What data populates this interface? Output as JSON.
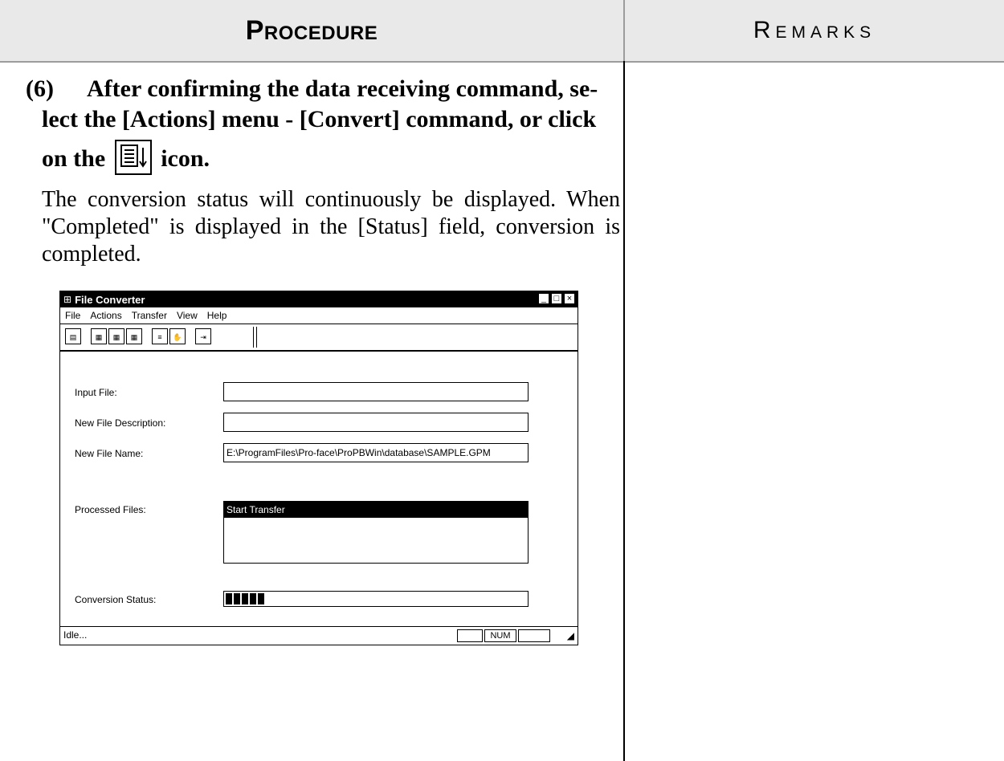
{
  "header": {
    "procedure": "Procedure",
    "remarks": "Remarks"
  },
  "step": {
    "number": "(6)",
    "line1": "After confirming the data receiving command, se-",
    "line2": "lect the [Actions] menu - [Convert] command, or click",
    "line3_pre": "on the",
    "line3_post": "icon.",
    "icon": "convert-icon"
  },
  "body": "The conversion status will continuously be displayed. When \"Completed\" is displayed in the [Status] field, conversion is completed.",
  "window": {
    "title": "File Converter",
    "menu": [
      "File",
      "Actions",
      "Transfer",
      "View",
      "Help"
    ],
    "toolbar": [
      "GPM",
      "GPM",
      "PROG",
      "PB",
      "convert",
      "stop",
      "exit"
    ],
    "labels": {
      "input_file": "Input File:",
      "new_desc": "New File Description:",
      "new_name": "New File Name:",
      "processed": "Processed Files:",
      "status": "Conversion Status:"
    },
    "values": {
      "input_file": "",
      "new_desc": "",
      "new_name": "E:\\ProgramFiles\\Pro-face\\ProPBWin\\database\\SAMPLE.GPM",
      "processed_selected": "Start Transfer"
    },
    "progress_blocks": 5,
    "status_text": "Idle...",
    "status_num": "NUM"
  }
}
